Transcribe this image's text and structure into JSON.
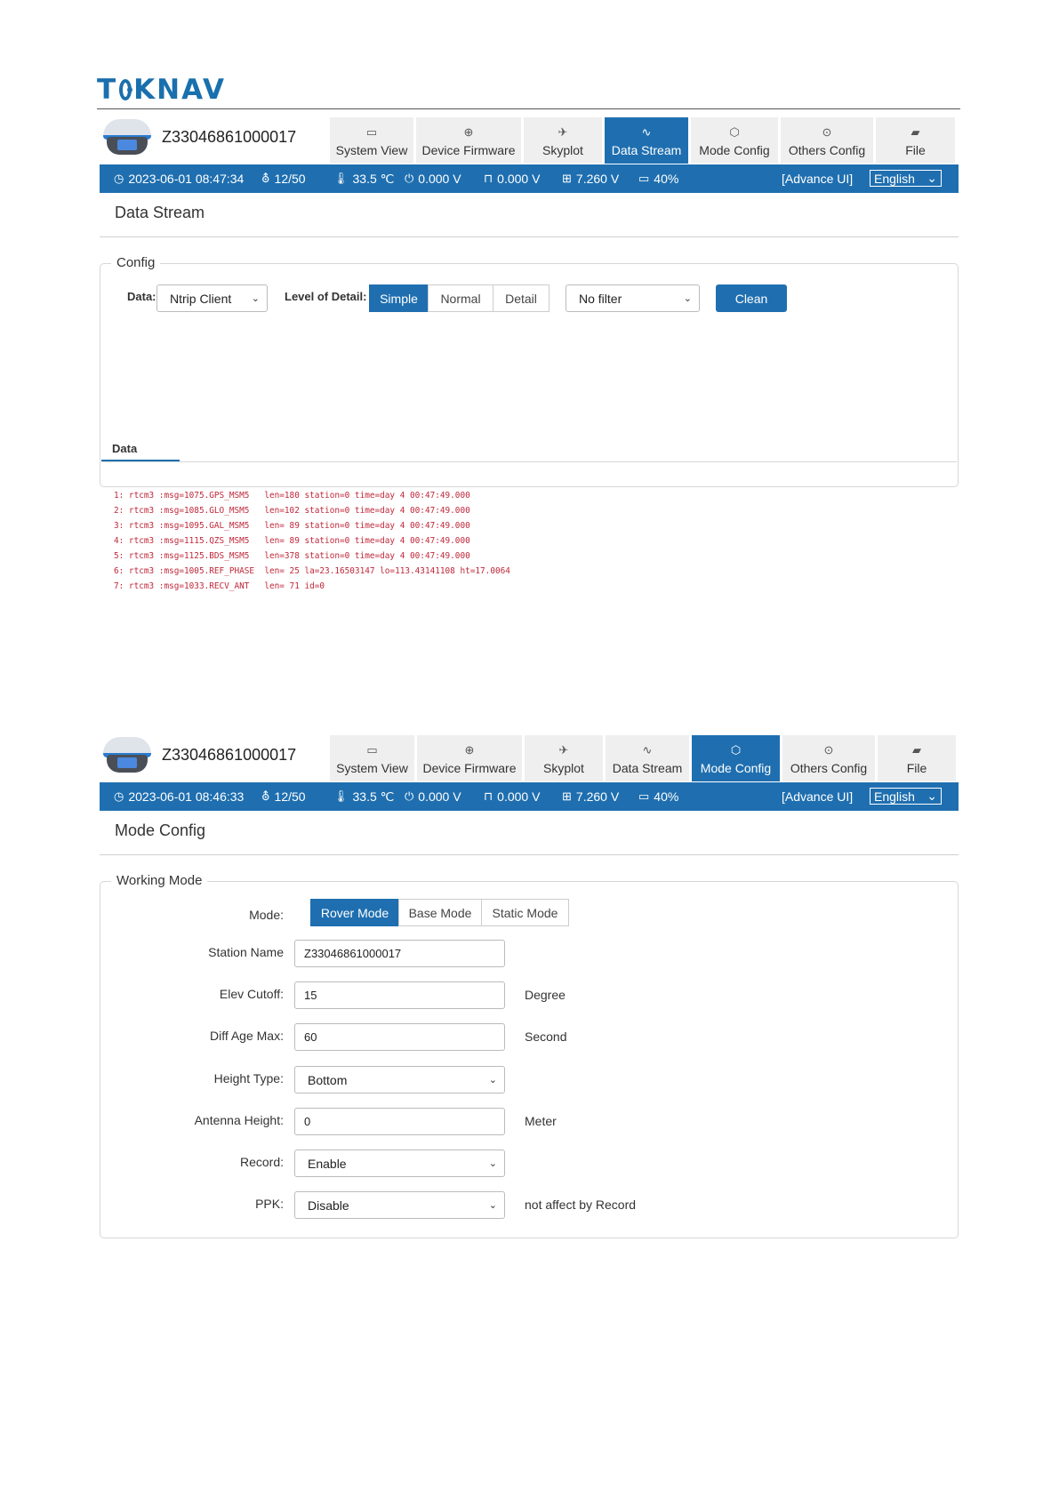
{
  "brand": {
    "logo_left": "T",
    "logo_right": "KNAV"
  },
  "device": {
    "serial": "Z33046861000017"
  },
  "tabs": [
    {
      "label": "System View",
      "icon": "monitor-icon"
    },
    {
      "label": "Device Firmware",
      "icon": "upload-icon"
    },
    {
      "label": "Skyplot",
      "icon": "satellite-icon"
    },
    {
      "label": "Data Stream",
      "icon": "pulse-icon"
    },
    {
      "label": "Mode Config",
      "icon": "cube-icon"
    },
    {
      "label": "Others Config",
      "icon": "more-icon"
    },
    {
      "label": "File",
      "icon": "folder-icon"
    }
  ],
  "status_common": {
    "satellites": "12/50",
    "temperature": "33.5 ℃",
    "voltage_1": "0.000 V",
    "voltage_2": "0.000 V",
    "battery_voltage": "7.260 V",
    "battery_percent": "40%",
    "advance_ui": "[Advance UI]",
    "language": "English"
  },
  "data_stream_screen": {
    "timestamp": "2023-06-01 08:47:34",
    "title": "Data Stream",
    "config_legend": "Config",
    "data_label": "Data:",
    "data_select": "Ntrip Client",
    "lod_label": "Level of Detail:",
    "lod_options": [
      "Simple",
      "Normal",
      "Detail"
    ],
    "lod_selected": "Simple",
    "filter_select": "No filter",
    "clean_button": "Clean",
    "data_tab": "Data",
    "log_lines": [
      "1: rtcm3 :msg=1075.GPS_MSM5   len=180 station=0 time=day 4 00:47:49.000",
      "2: rtcm3 :msg=1085.GLO_MSM5   len=102 station=0 time=day 4 00:47:49.000",
      "3: rtcm3 :msg=1095.GAL_MSM5   len= 89 station=0 time=day 4 00:47:49.000",
      "4: rtcm3 :msg=1115.QZS_MSM5   len= 89 station=0 time=day 4 00:47:49.000",
      "5: rtcm3 :msg=1125.BDS_MSM5   len=378 station=0 time=day 4 00:47:49.000",
      "6: rtcm3 :msg=1005.REF_PHASE  len= 25 la=23.16503147 lo=113.43141108 ht=17.0064",
      "7: rtcm3 :msg=1033.RECV_ANT   len= 71 id=0"
    ]
  },
  "mode_config_screen": {
    "timestamp": "2023-06-01 08:46:33",
    "title": "Mode Config",
    "working_mode_legend": "Working Mode",
    "mode_label": "Mode:",
    "mode_options": [
      "Rover Mode",
      "Base Mode",
      "Static Mode"
    ],
    "mode_selected": "Rover Mode",
    "station_name_label": "Station Name",
    "station_name_value": "Z33046861000017",
    "elev_cutoff_label": "Elev Cutoff:",
    "elev_cutoff_value": "15",
    "elev_cutoff_unit": "Degree",
    "diff_age_label": "Diff Age Max:",
    "diff_age_value": "60",
    "diff_age_unit": "Second",
    "height_type_label": "Height Type:",
    "height_type_value": "Bottom",
    "antenna_height_label": "Antenna Height:",
    "antenna_height_value": "0",
    "antenna_height_unit": "Meter",
    "record_label": "Record:",
    "record_value": "Enable",
    "ppk_label": "PPK:",
    "ppk_value": "Disable",
    "ppk_note": "not affect by Record"
  },
  "colors": {
    "accent": "#1f6fb0",
    "log_text": "#c0283a",
    "tab_bg": "#efefef"
  }
}
